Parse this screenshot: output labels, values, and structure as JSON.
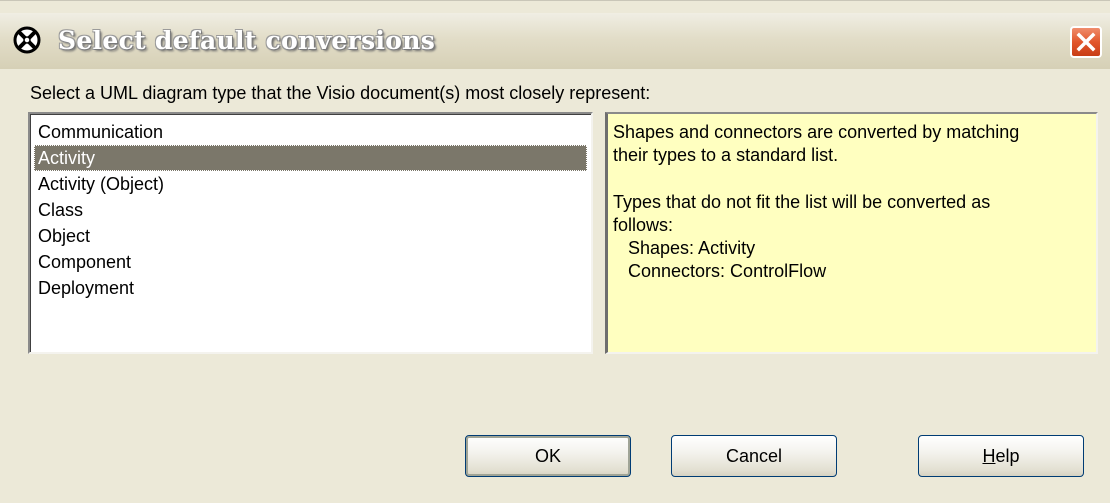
{
  "window": {
    "title": "Select default conversions",
    "app_icon": "visio-uml-icon",
    "close_icon": "close-x-icon",
    "close_color": "#e2562c"
  },
  "prompt": "Select a UML diagram type that the Visio document(s) most closely represent:",
  "diagram_types": {
    "items": [
      "Communication",
      "Activity",
      "Activity (Object)",
      "Class",
      "Object",
      "Component",
      "Deployment"
    ],
    "selected": "Activity"
  },
  "description": {
    "line1": "Shapes and connectors are converted by matching",
    "line2": "their types to a standard list.",
    "line3": "Types that do not fit the list will be converted as",
    "line4": "follows:",
    "line5": "   Shapes: Activity",
    "line6": "   Connectors: ControlFlow",
    "background": "#ffffc0"
  },
  "buttons": {
    "ok": "OK",
    "cancel": "Cancel",
    "help_mnemonic": "H",
    "help_rest": "elp"
  }
}
